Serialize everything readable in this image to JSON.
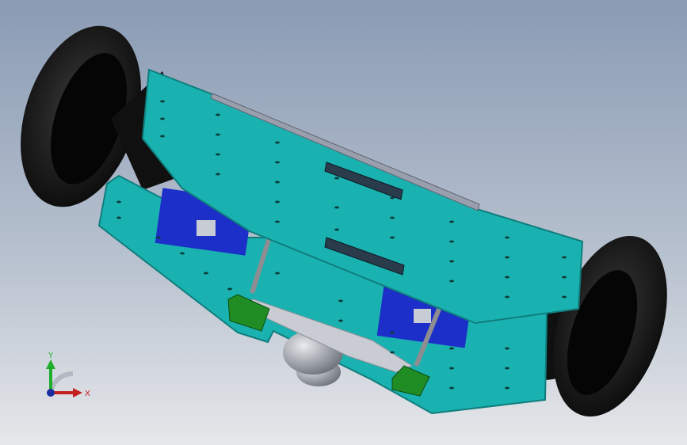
{
  "viewport": {
    "triad": {
      "y_label": "Y",
      "x_label": "X",
      "colors": {
        "y": "#1fae2a",
        "x": "#c42020",
        "z": "#1a2ea0"
      }
    },
    "colors": {
      "plate": "#1ab2b0",
      "plate_edge": "#0f7d7d",
      "tire": "#141414",
      "motor_mount": "#1c2fc8",
      "bracket": "#1f8c24",
      "strut": "#8d8d92",
      "ball_caster": "#b8bdc4",
      "rail": "#9a9fae"
    }
  }
}
